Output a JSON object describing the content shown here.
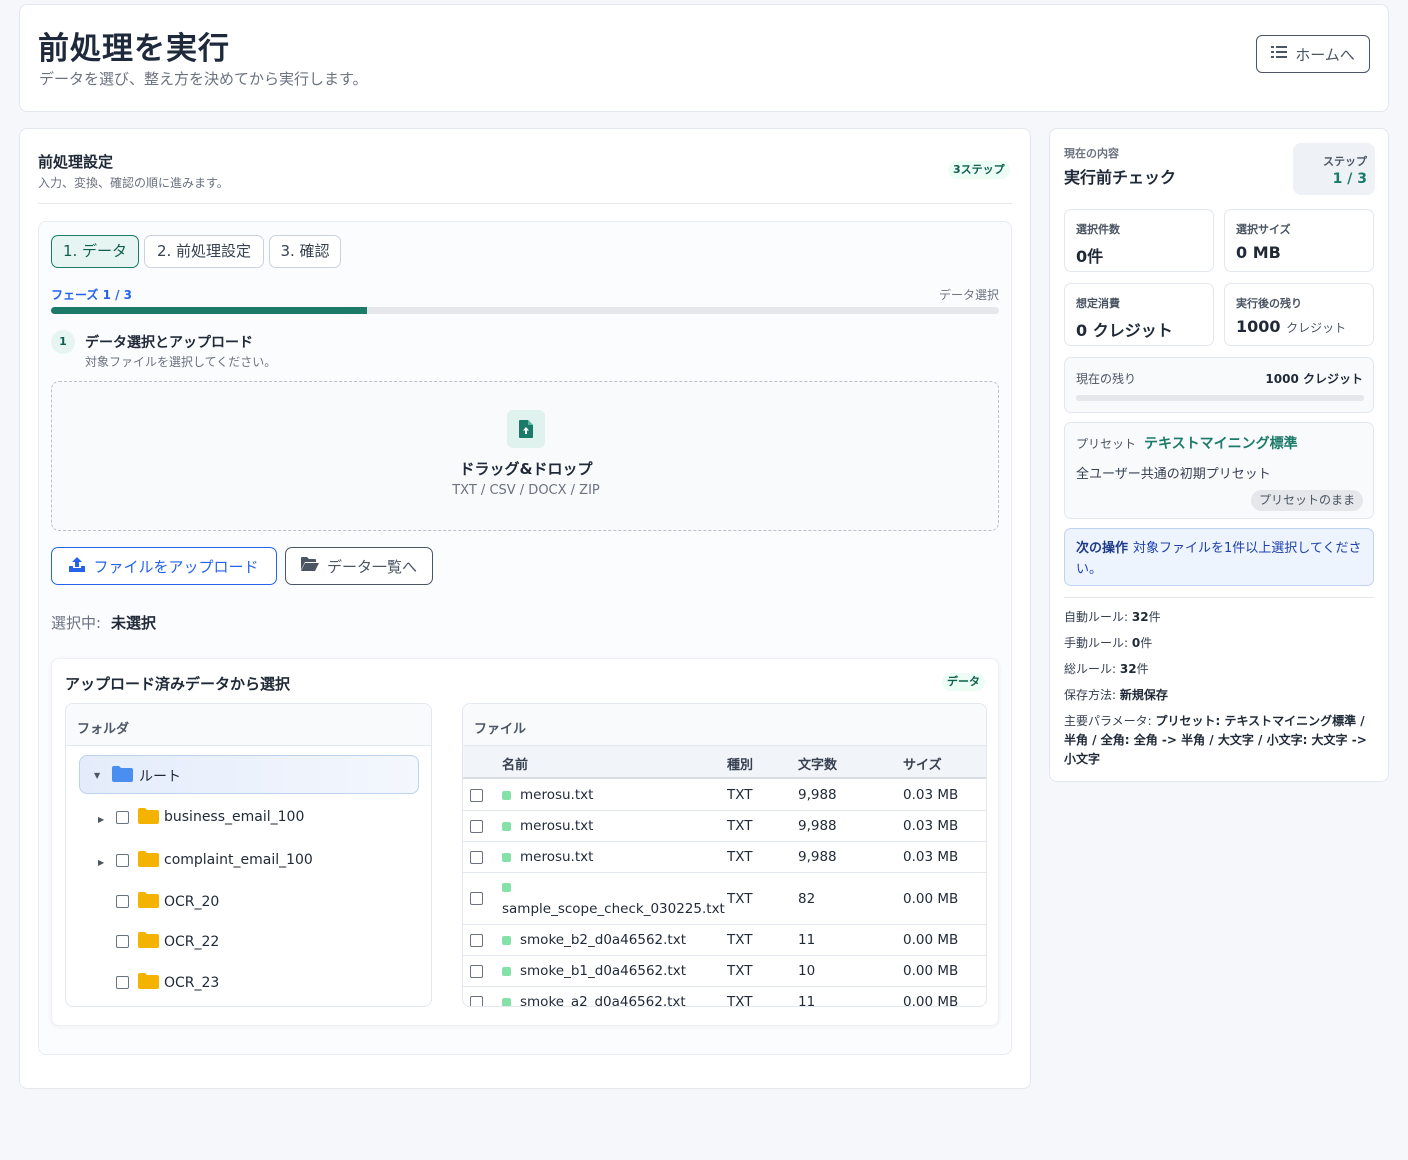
{
  "header": {
    "title": "前処理を実行",
    "subtitle": "データを選び、整え方を決めてから実行します。",
    "home_button": "ホームへ"
  },
  "settings": {
    "title": "前処理設定",
    "description": "入力、変換、確認の順に進みます。",
    "steps_badge": "3ステップ",
    "tabs": [
      {
        "label": "1. データ",
        "active": true
      },
      {
        "label": "2. 前処理設定",
        "active": false
      },
      {
        "label": "3. 確認",
        "active": false
      }
    ],
    "phase_label": "フェーズ 1 / 3",
    "phase_name": "データ選択",
    "progress_fraction": 0.333
  },
  "data_step": {
    "number": "1",
    "title": "データ選択とアップロード",
    "description": "対象ファイルを選択してください。",
    "dropzone_title": "ドラッグ&ドロップ",
    "dropzone_types": "TXT / CSV / DOCX / ZIP",
    "upload_button": "ファイルをアップロード",
    "list_button": "データ一覧へ",
    "selected_label": "選択中:",
    "selected_value": "未選択"
  },
  "uploaded": {
    "title": "アップロード済みデータから選択",
    "badge": "データ",
    "folder_header": "フォルダ",
    "file_header": "ファイル",
    "root_label": "ルート",
    "folders": [
      {
        "name": "business_email_100",
        "expandable": true
      },
      {
        "name": "complaint_email_100",
        "expandable": true
      },
      {
        "name": "OCR_20",
        "expandable": false
      },
      {
        "name": "OCR_22",
        "expandable": false
      },
      {
        "name": "OCR_23",
        "expandable": false
      }
    ],
    "columns": [
      "名前",
      "種別",
      "文字数",
      "サイズ"
    ],
    "files": [
      {
        "name": "merosu.txt",
        "type": "TXT",
        "chars": "9,988",
        "size": "0.03 MB"
      },
      {
        "name": "merosu.txt",
        "type": "TXT",
        "chars": "9,988",
        "size": "0.03 MB"
      },
      {
        "name": "merosu.txt",
        "type": "TXT",
        "chars": "9,988",
        "size": "0.03 MB"
      },
      {
        "name": "sample_scope_check_030225.txt",
        "type": "TXT",
        "chars": "82",
        "size": "0.00 MB"
      },
      {
        "name": "smoke_b2_d0a46562.txt",
        "type": "TXT",
        "chars": "11",
        "size": "0.00 MB"
      },
      {
        "name": "smoke_b1_d0a46562.txt",
        "type": "TXT",
        "chars": "10",
        "size": "0.00 MB"
      },
      {
        "name": "smoke_a2_d0a46562.txt",
        "type": "TXT",
        "chars": "11",
        "size": "0.00 MB"
      }
    ]
  },
  "sidebar": {
    "kicker": "現在の内容",
    "title": "実行前チェック",
    "step_label": "ステップ",
    "step_value": "1 / 3",
    "stats": {
      "selected_count_label": "選択件数",
      "selected_count_value": "0件",
      "selected_size_label": "選択サイズ",
      "selected_size_value": "0 MB",
      "estimated_label": "想定消費",
      "estimated_value": "0 クレジット",
      "after_label": "実行後の残り",
      "after_value": "1000",
      "after_unit": "クレジット"
    },
    "remaining_label": "現在の残り",
    "remaining_value": "1000 クレジット",
    "preset_label": "プリセット",
    "preset_name": "テキストマイニング標準",
    "preset_desc": "全ユーザー共通の初期プリセット",
    "preset_badge": "プリセットのまま",
    "next_label": "次の操作",
    "next_text": "対象ファイルを1件以上選択してください。",
    "meta": {
      "auto_rules_label": "自動ルール:",
      "auto_rules_value": "32",
      "auto_rules_unit": "件",
      "manual_rules_label": "手動ルール:",
      "manual_rules_value": "0",
      "manual_rules_unit": "件",
      "total_rules_label": "総ルール:",
      "total_rules_value": "32",
      "total_rules_unit": "件",
      "save_label": "保存方法:",
      "save_value": "新規保存",
      "params_label": "主要パラメータ:",
      "params_value": "プリセット: テキストマイニング標準 / 半角 / 全角: 全角 -> 半角 / 大文字 / 小文字: 大文字 -> 小文字"
    }
  },
  "colors": {
    "accent_green": "#1b7a68",
    "accent_blue": "#2563eb",
    "folder_yellow": "#f5b301",
    "root_folder_blue": "#4a8ef0",
    "file_dot": "#86e1a8"
  }
}
